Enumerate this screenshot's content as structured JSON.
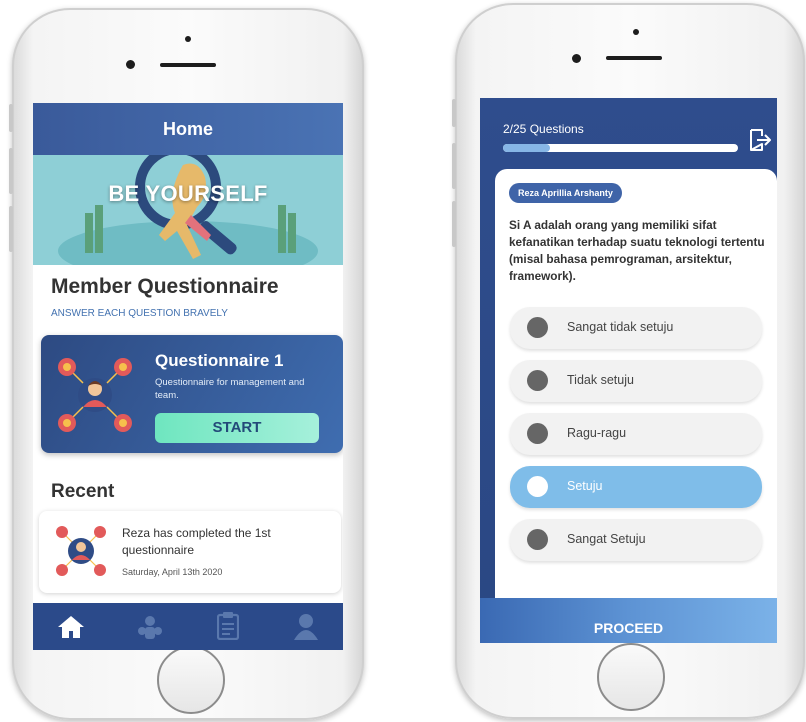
{
  "left_screen": {
    "header_title": "Home",
    "banner_text": "BE YOURSELF",
    "section_title": "Member Questionnaire",
    "section_subtitle": "ANSWER EACH QUESTION BRAVELY",
    "questionnaire_card": {
      "title": "Questionnaire 1",
      "description": "Questionnaire for management and team.",
      "button_label": "START"
    },
    "recent_title": "Recent",
    "recent_item": {
      "text": "Reza has completed the 1st questionnaire",
      "date": "Saturday, April 13th 2020"
    },
    "nav_items": [
      "home-icon",
      "team-icon",
      "clipboard-icon",
      "user-icon"
    ]
  },
  "right_screen": {
    "progress_label": "2/25 Questions",
    "progress_fraction": 0.2,
    "author": "Reza Aprillia Arshanty",
    "question": "Si A adalah orang yang memiliki sifat kefanatikan terhadap suatu teknologi tertentu (misal bahasa pemrograman, arsitektur, framework).",
    "options": [
      {
        "label": "Sangat tidak setuju",
        "selected": false
      },
      {
        "label": "Tidak setuju",
        "selected": false
      },
      {
        "label": "Ragu-ragu",
        "selected": false
      },
      {
        "label": "Setuju",
        "selected": true
      },
      {
        "label": "Sangat Setuju",
        "selected": false
      }
    ],
    "proceed_label": "PROCEED"
  },
  "colors": {
    "primary": "#2b4a8a",
    "accent": "#7fbde9",
    "start_button": "#6ee6bf"
  }
}
